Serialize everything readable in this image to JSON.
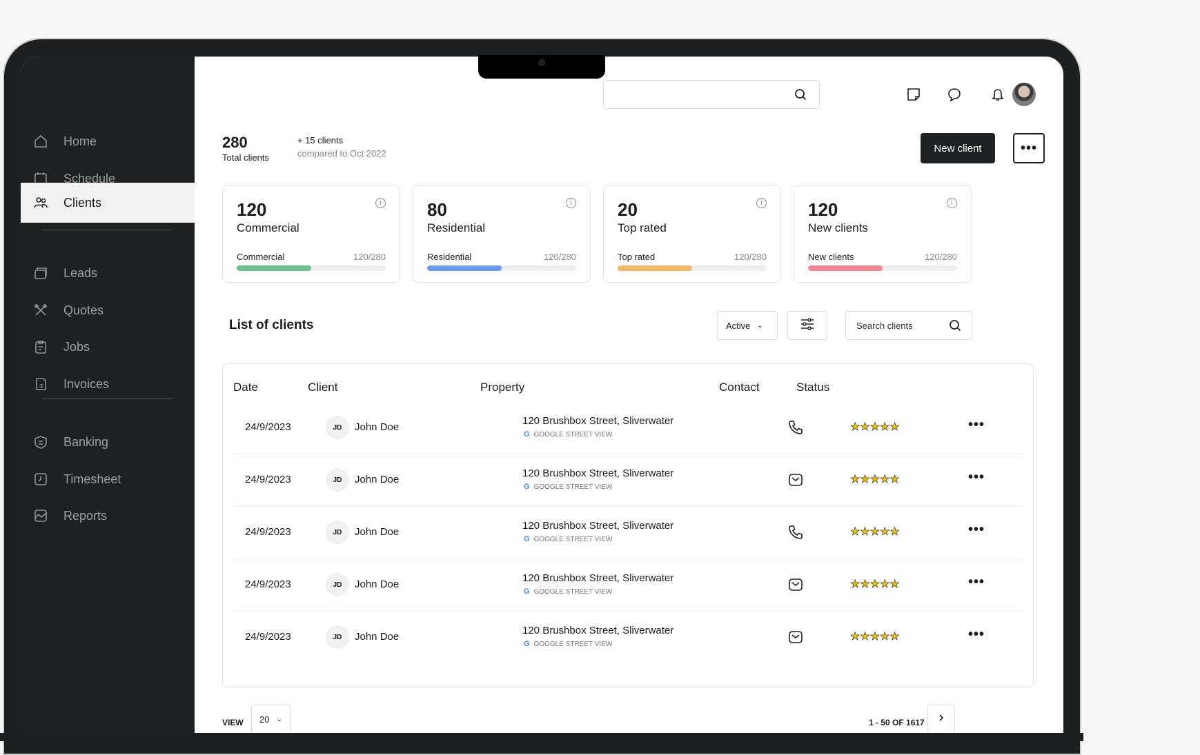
{
  "sidebar": {
    "items": [
      {
        "label": "Home",
        "icon": "home-icon"
      },
      {
        "label": "Schedule",
        "icon": "calendar-icon"
      },
      {
        "label": "Clients",
        "icon": "users-icon",
        "active": true
      },
      {
        "label": "Leads",
        "icon": "cards-icon"
      },
      {
        "label": "Quotes",
        "icon": "tools-icon"
      },
      {
        "label": "Jobs",
        "icon": "clipboard-icon"
      },
      {
        "label": "Invoices",
        "icon": "invoice-icon"
      },
      {
        "label": "Banking",
        "icon": "bank-icon"
      },
      {
        "label": "Timesheet",
        "icon": "clock-icon"
      },
      {
        "label": "Reports",
        "icon": "chart-icon"
      }
    ]
  },
  "summary": {
    "total": "280",
    "total_label": "Total clients",
    "delta": "+ 15 clients",
    "delta_sub": "compared to Oct 2022"
  },
  "actions": {
    "new_client": "New client",
    "more": "•••"
  },
  "cards": [
    {
      "num": "120",
      "name": "Commercial",
      "bar_label": "Commercial",
      "bar_value": "120/280",
      "fraction": 0.5,
      "color": "#6cc18e"
    },
    {
      "num": "80",
      "name": "Residential",
      "bar_label": "Residential",
      "bar_value": "120/280",
      "fraction": 0.5,
      "color": "#6e9be8"
    },
    {
      "num": "20",
      "name": "Top rated",
      "bar_label": "Top rated",
      "bar_value": "120/280",
      "fraction": 0.5,
      "color": "#f5b66c"
    },
    {
      "num": "120",
      "name": "New clients",
      "bar_label": "New clients",
      "bar_value": "120/280",
      "fraction": 0.5,
      "color": "#ef8a94"
    }
  ],
  "list": {
    "title": "List of clients",
    "status_filter": "Active",
    "search_placeholder": "Search clients",
    "headers": {
      "date": "Date",
      "client": "Client",
      "property": "Property",
      "contact": "Contact",
      "status": "Status"
    },
    "rows": [
      {
        "date": "24/9/2023",
        "initials": "JD",
        "client": "John Doe",
        "address": "120 Brushbox Street, Sliverwater",
        "street_view": "GOOGLE STREET VIEW",
        "contact": "phone-icon",
        "stars": "★★★★★"
      },
      {
        "date": "24/9/2023",
        "initials": "JD",
        "client": "John Doe",
        "address": "120 Brushbox Street, Sliverwater",
        "street_view": "GOOGLE STREET VIEW",
        "contact": "mail-icon",
        "stars": "★★★★★"
      },
      {
        "date": "24/9/2023",
        "initials": "JD",
        "client": "John Doe",
        "address": "120 Brushbox Street, Sliverwater",
        "street_view": "GOOGLE STREET VIEW",
        "contact": "phone-icon",
        "stars": "★★★★★"
      },
      {
        "date": "24/9/2023",
        "initials": "JD",
        "client": "John Doe",
        "address": "120 Brushbox Street, Sliverwater",
        "street_view": "GOOGLE STREET VIEW",
        "contact": "mail-icon",
        "stars": "★★★★★"
      },
      {
        "date": "24/9/2023",
        "initials": "JD",
        "client": "John Doe",
        "address": "120 Brushbox Street, Sliverwater",
        "street_view": "GOOGLE STREET VIEW",
        "contact": "mail-icon",
        "stars": "★★★★★"
      }
    ]
  },
  "footer": {
    "view_label": "VIEW",
    "view_value": "20",
    "pager": "1 - 50 OF 1617"
  }
}
